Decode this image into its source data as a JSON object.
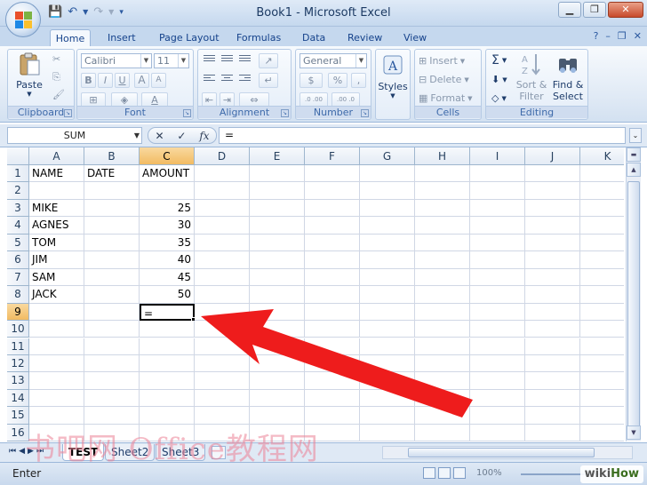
{
  "window": {
    "title": "Book1 - Microsoft Excel",
    "minimize": "▁",
    "restore": "❐",
    "close": "✕"
  },
  "ribbon_tabs": [
    "Home",
    "Insert",
    "Page Layout",
    "Formulas",
    "Data",
    "Review",
    "View"
  ],
  "ribbon_controls": {
    "help": "?",
    "minimize": "–",
    "restore": "❐",
    "close": "✕"
  },
  "groups": {
    "clipboard": {
      "label": "Clipboard",
      "paste": "Paste"
    },
    "font": {
      "label": "Font",
      "name": "Calibri",
      "size": "11",
      "bold": "B",
      "italic": "I",
      "underline": "U",
      "grow": "A",
      "shrink": "A"
    },
    "alignment": {
      "label": "Alignment"
    },
    "number": {
      "label": "Number",
      "format": "General",
      "currency": "$",
      "percent": "%",
      "comma": ",",
      "inc_decimal": ".0 .00",
      "dec_decimal": ".00 .0"
    },
    "styles": {
      "label": "Styles"
    },
    "cells": {
      "label": "Cells",
      "insert": "Insert",
      "delete": "Delete",
      "format": "Format"
    },
    "editing": {
      "label": "Editing",
      "sum": "Σ",
      "sort": "Sort &",
      "filter": "Filter",
      "find": "Find &",
      "select": "Select"
    }
  },
  "formula_bar": {
    "name_box": "SUM",
    "cancel": "✕",
    "enter": "✓",
    "fx": "fx",
    "content": "="
  },
  "columns": [
    "A",
    "B",
    "C",
    "D",
    "E",
    "F",
    "G",
    "H",
    "I",
    "J",
    "K"
  ],
  "rows": [
    "1",
    "2",
    "3",
    "4",
    "5",
    "6",
    "7",
    "8",
    "9",
    "10",
    "11",
    "12",
    "13",
    "14",
    "15",
    "16"
  ],
  "cells": {
    "A1": "NAME",
    "B1": "DATE",
    "C1": "AMOUNT",
    "A3": "MIKE",
    "C3": "25",
    "A4": "AGNES",
    "C4": "30",
    "A5": "TOM",
    "C5": "35",
    "A6": "JIM",
    "C6": "40",
    "A7": "SAM",
    "C7": "45",
    "A8": "JACK",
    "C8": "50",
    "C9": "="
  },
  "active_cell": "C9",
  "sheets": [
    "TEST",
    "Sheet2",
    "Sheet3"
  ],
  "active_sheet": "TEST",
  "status": {
    "mode": "Enter",
    "zoom": "100%"
  },
  "watermark": "书吧网 Office教程网",
  "wikihow": {
    "wiki": "wiki",
    "how": "How"
  },
  "colors": {
    "arrow": "#ee1c1c",
    "selection_header": "#f6c36f",
    "ribbon": "#dfe9f5"
  }
}
